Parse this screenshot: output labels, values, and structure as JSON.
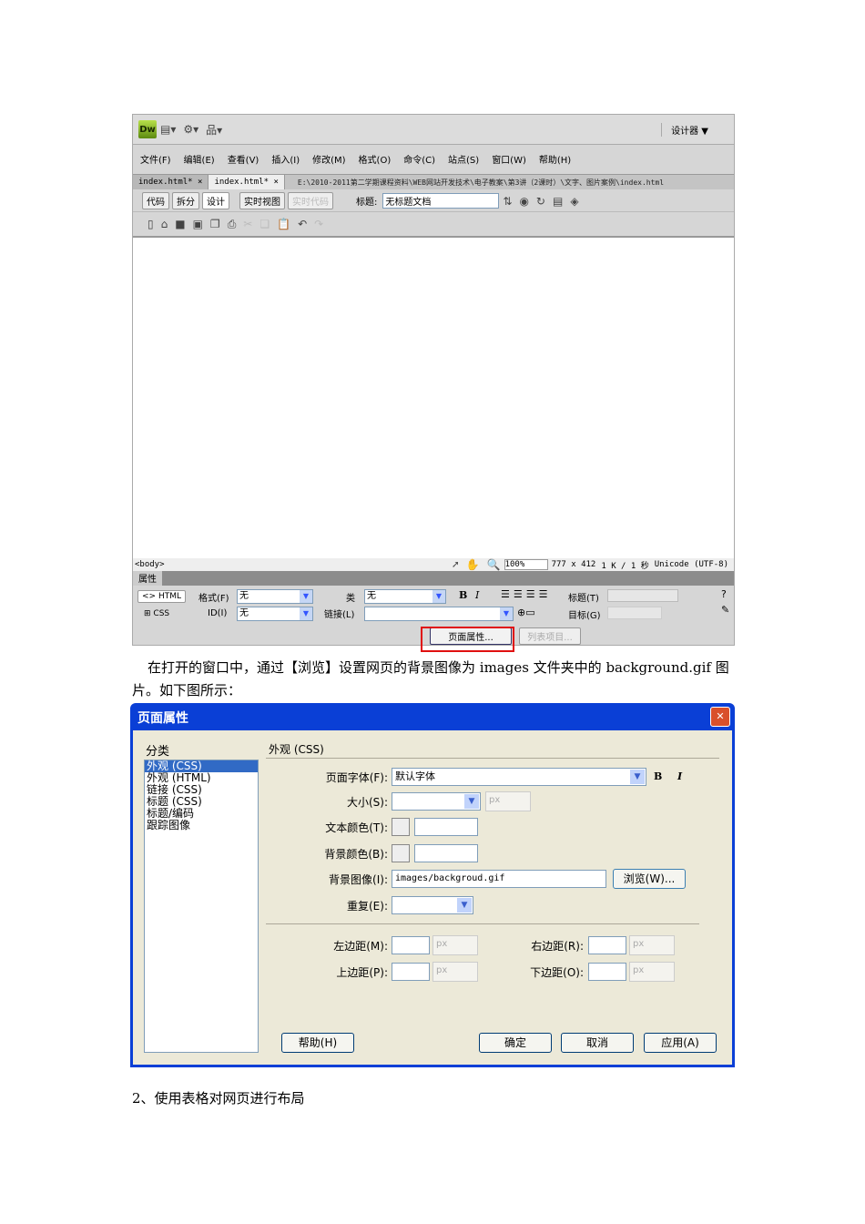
{
  "dw": {
    "logo": "Dw",
    "workspace": "设计器 ▼",
    "menu": [
      "文件(F)",
      "编辑(E)",
      "查看(V)",
      "插入(I)",
      "修改(M)",
      "格式(O)",
      "命令(C)",
      "站点(S)",
      "窗口(W)",
      "帮助(H)"
    ],
    "tabs": [
      "index.html*",
      "index.html*"
    ],
    "path": "E:\\2010-2011第二学期课程资料\\WEB网站开发技术\\电子教案\\第3讲（2课时）\\文字、图片案例\\index.html",
    "views": [
      "代码",
      "拆分",
      "设计"
    ],
    "live_view": "实时视图",
    "live_code": "实时代码",
    "title_label": "标题:",
    "title_value": "无标题文档",
    "status": {
      "tag": "<body>",
      "zoom": "100%",
      "size": "777 x 412",
      "weight": "1 K / 1 秒",
      "encoding": "Unicode (UTF-8)"
    },
    "props": {
      "header": "属性",
      "html": "HTML",
      "css": "CSS",
      "format_label": "格式(F)",
      "format_value": "无",
      "id_label": "ID(I)",
      "id_value": "无",
      "class_label": "类",
      "class_value": "无",
      "link_label": "链接(L)",
      "bold": "B",
      "italic": "I",
      "title_label": "标题(T)",
      "target_label": "目标(G)",
      "page_props": "页面属性...",
      "list_item": "列表项目..."
    }
  },
  "text": {
    "para": "在打开的窗口中，通过【浏览】设置网页的背景图像为 images 文件夹中的 background.gif 图片。如下图所示：",
    "heading": "2、使用表格对网页进行布局"
  },
  "dialog": {
    "title": "页面属性",
    "close": "✕",
    "category_label": "分类",
    "categories": [
      "外观 (CSS)",
      "外观 (HTML)",
      "链接 (CSS)",
      "标题 (CSS)",
      "标题/编码",
      "跟踪图像"
    ],
    "section": "外观 (CSS)",
    "font_label": "页面字体(F):",
    "font_value": "默认字体",
    "bold": "B",
    "italic": "I",
    "size_label": "大小(S):",
    "unit": "px",
    "text_color_label": "文本颜色(T):",
    "bg_color_label": "背景颜色(B):",
    "bg_image_label": "背景图像(I):",
    "bg_image_value": "images/backgroud.gif",
    "browse": "浏览(W)...",
    "repeat_label": "重复(E):",
    "left_margin": "左边距(M):",
    "right_margin": "右边距(R):",
    "top_margin": "上边距(P):",
    "bottom_margin": "下边距(O):",
    "help": "帮助(H)",
    "ok": "确定",
    "cancel": "取消",
    "apply": "应用(A)"
  }
}
